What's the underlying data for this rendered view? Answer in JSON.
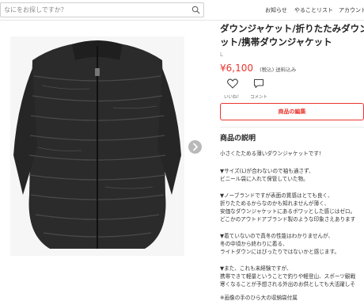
{
  "header": {
    "search_placeholder": "なにをお探しですか？",
    "nav": [
      "お知らせ",
      "やることリスト",
      "アカウント"
    ]
  },
  "item": {
    "title_lines": [
      "ダウンジャケット/折りたたみダウン",
      "ット/携帯ダウンジャケット"
    ],
    "size": "L",
    "price": "¥6,100",
    "tax_note": "(税込) 送料込み",
    "like_label": "いいね！",
    "comment_label": "コメント",
    "edit_button": "商品の編集"
  },
  "description": {
    "heading": "商品の説明",
    "lines": [
      "小さくたためる薄いダウンジャケットです!",
      "",
      "▼サイズ(L)が合わないので袖も通さず、",
      "ビニール袋に入れて保管していた物。",
      "",
      "▼ノーブランドですが表面の質感はとても良く、",
      "折りたためるからなのかも知れませんが薄く、",
      "安価なダウンジャケットにあるボワッとした感じはゼロ。",
      "どこかのアウトドアブランド製のような印象さえあります",
      "",
      "▼着ていないので真冬の性能はわかりませんが、",
      "冬の中頃から終わりに着る、",
      "ライトダウンにはぴったりではないかと感じます。",
      "",
      "▼また、これも未経験ですが、",
      "携帯できて軽量ということで釣りや軽登山、スポーツ観戦",
      "寒くなることが予想される外出のお供としても大活躍しそ",
      "",
      "※画像の手のひら大の収納袋付属"
    ]
  }
}
